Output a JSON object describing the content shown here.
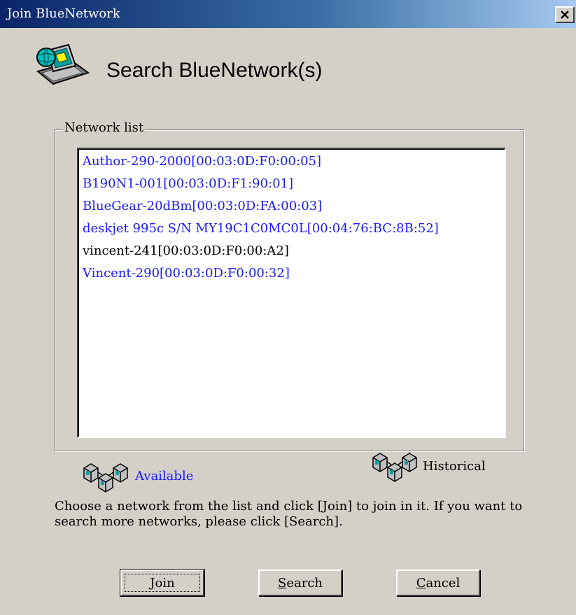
{
  "window": {
    "title": "Join BlueNetwork",
    "close_glyph": "×"
  },
  "header": {
    "icon": "network-computer-icon",
    "title": "Search BlueNetwork(s)"
  },
  "network_list": {
    "label": "Network list",
    "items": [
      {
        "text": "Author-290-2000[00:03:0D:F0:00:05]",
        "status": "available",
        "color": "#1a1aff"
      },
      {
        "text": "B190N1-001[00:03:0D:F1:90:01]",
        "status": "available",
        "color": "#1a1aff"
      },
      {
        "text": "BlueGear-20dBm[00:03:0D:FA:00:03]",
        "status": "available",
        "color": "#1a1aff"
      },
      {
        "text": "deskjet 995c S/N MY19C1C0MC0L[00:04:76:BC:8B:52]",
        "status": "available",
        "color": "#1a1aff"
      },
      {
        "text": "vincent-241[00:03:0D:F0:00:A2]",
        "status": "historical",
        "color": "#000000"
      },
      {
        "text": "Vincent-290[00:03:0D:F0:00:32]",
        "status": "available",
        "color": "#1a1aff"
      }
    ]
  },
  "legend": {
    "available": {
      "label": "Available",
      "color": "#1a1aff",
      "icon": "network-cubes-icon"
    },
    "historical": {
      "label": "Historical",
      "color": "#000000",
      "icon": "network-cubes-icon"
    }
  },
  "instructions": "Choose a network from the list and click [Join] to join in it. If you want to search more networks, please click [Search].",
  "buttons": {
    "join": {
      "mnemonic": "J",
      "rest": "oin"
    },
    "search": {
      "mnemonic": "S",
      "rest": "earch"
    },
    "cancel": {
      "mnemonic": "C",
      "rest": "ancel"
    }
  },
  "colors": {
    "dialog_bg": "#d4d0c8",
    "title_bar_start": "#0a246a",
    "title_bar_end": "#a6caf0",
    "available_text": "#1a1aff",
    "historical_text": "#000000"
  }
}
